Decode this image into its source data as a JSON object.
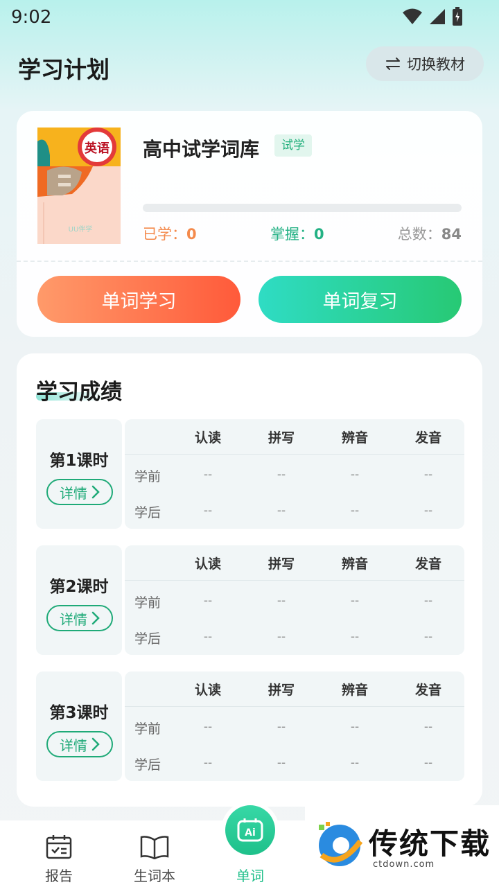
{
  "status_bar": {
    "time": "9:02"
  },
  "header": {
    "title": "学习计划",
    "switch_label": "切换教材"
  },
  "book": {
    "cover_text": "英语",
    "cover_brand": "UU伴学",
    "title": "高中试学词库",
    "tag": "试学",
    "progress": 0,
    "learned_label": "已学：",
    "learned_value": "0",
    "mastered_label": "掌握：",
    "mastered_value": "0",
    "total_label": "总数：",
    "total_value": "84",
    "study_button": "单词学习",
    "review_button": "单词复习"
  },
  "results": {
    "title": "学习成绩",
    "columns": [
      "认读",
      "拼写",
      "辨音",
      "发音"
    ],
    "row_labels": [
      "学前",
      "学后"
    ],
    "detail_label": "详情",
    "lessons": [
      {
        "name": "第1课时",
        "before": [
          "--",
          "--",
          "--",
          "--"
        ],
        "after": [
          "--",
          "--",
          "--",
          "--"
        ]
      },
      {
        "name": "第2课时",
        "before": [
          "--",
          "--",
          "--",
          "--"
        ],
        "after": [
          "--",
          "--",
          "--",
          "--"
        ]
      },
      {
        "name": "第3课时",
        "before": [
          "--",
          "--",
          "--",
          "--"
        ],
        "after": [
          "--",
          "--",
          "--",
          "--"
        ]
      }
    ]
  },
  "nav": {
    "items": [
      {
        "label": "报告",
        "icon": "calendar-check-icon"
      },
      {
        "label": "生词本",
        "icon": "open-book-icon"
      },
      {
        "label": "单词",
        "icon": "ai-icon"
      }
    ],
    "active_color": "#1fbf8a"
  },
  "watermark": {
    "text": "传统下载",
    "sub": "ctdown.com"
  },
  "colors": {
    "accent_orange": "#ff6a45",
    "accent_green": "#23c47f"
  }
}
